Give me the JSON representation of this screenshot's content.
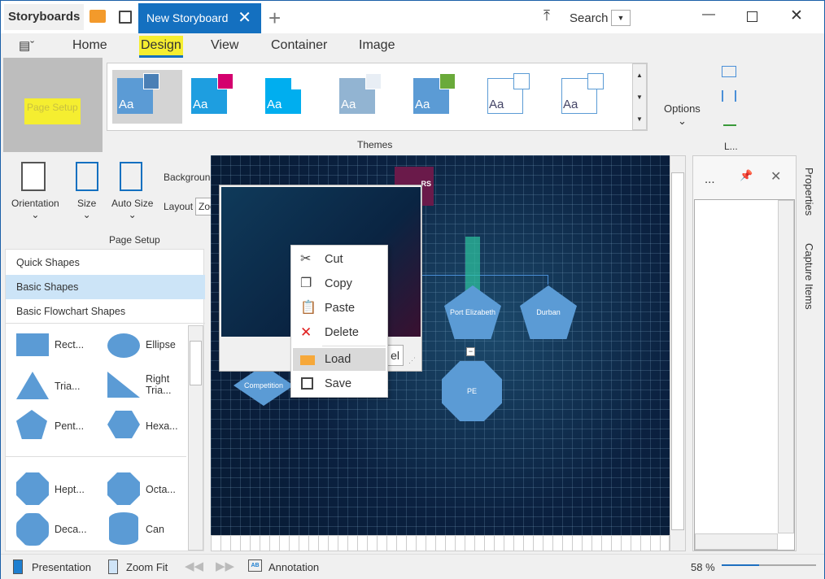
{
  "titlebar": {
    "app_name": "Storyboards",
    "tab_label": "New Storyboard",
    "search_label": "Search"
  },
  "menu": {
    "tabs": [
      "Home",
      "Design",
      "View",
      "Container",
      "Image"
    ],
    "active": "Design"
  },
  "ribbon": {
    "page_setup_collapsed": "Page Setup",
    "themes_label": "Themes",
    "themes": [
      {
        "main": "#5b9bd5",
        "accent": "#4a7fb5"
      },
      {
        "main": "#1e9ee0",
        "accent": "#d4006e"
      },
      {
        "main": "#00aeef",
        "accent": "#ffffff"
      },
      {
        "main": "#92b4d2",
        "accent": "#e8eef5"
      },
      {
        "main": "#5b9bd5",
        "accent": "#6aaa3a"
      },
      {
        "main": "#ffffff",
        "accent": "#ffffff"
      },
      {
        "main": "#ffffff",
        "accent": "#ffffff"
      }
    ],
    "options_label": "Options",
    "layout_group_label": "L...",
    "orientation_label": "Orientation",
    "size_label": "Size",
    "auto_size_label": "Auto Size",
    "background_label": "Background",
    "layout_label": "Layout",
    "layout_value": "Zoom",
    "page_setup_group_label": "Page Setup"
  },
  "shapes_panel": {
    "categories": [
      "Quick Shapes",
      "Basic Shapes",
      "Basic Flowchart Shapes"
    ],
    "selected": "Basic Shapes",
    "shapes": [
      "Rect...",
      "Ellipse",
      "Tria...",
      "Right Tria...",
      "Pent...",
      "Hexa...",
      "Hept...",
      "Octa...",
      "Deca...",
      "Can"
    ]
  },
  "context_menu": {
    "items": [
      "Cut",
      "Copy",
      "Paste",
      "Delete",
      "Load",
      "Save"
    ],
    "highlighted": "Load"
  },
  "popup": {
    "button_partial": "el"
  },
  "canvas": {
    "nodes": [
      "Port Elizabeth",
      "Durban",
      "PE",
      "Competition"
    ],
    "logo_text": "RS"
  },
  "right_panel": {
    "title": "...",
    "tabs": [
      "Properties",
      "Capture Items"
    ]
  },
  "status": {
    "presentation": "Presentation",
    "zoom_fit": "Zoom Fit",
    "annotation": "Annotation",
    "zoom": "58 %",
    "zoom_fraction": 0.4
  },
  "colors": {
    "accent": "#1470c0",
    "shape": "#5b9bd5",
    "highlight": "#f5ee30",
    "menu_hover": "#d9d9d9"
  }
}
